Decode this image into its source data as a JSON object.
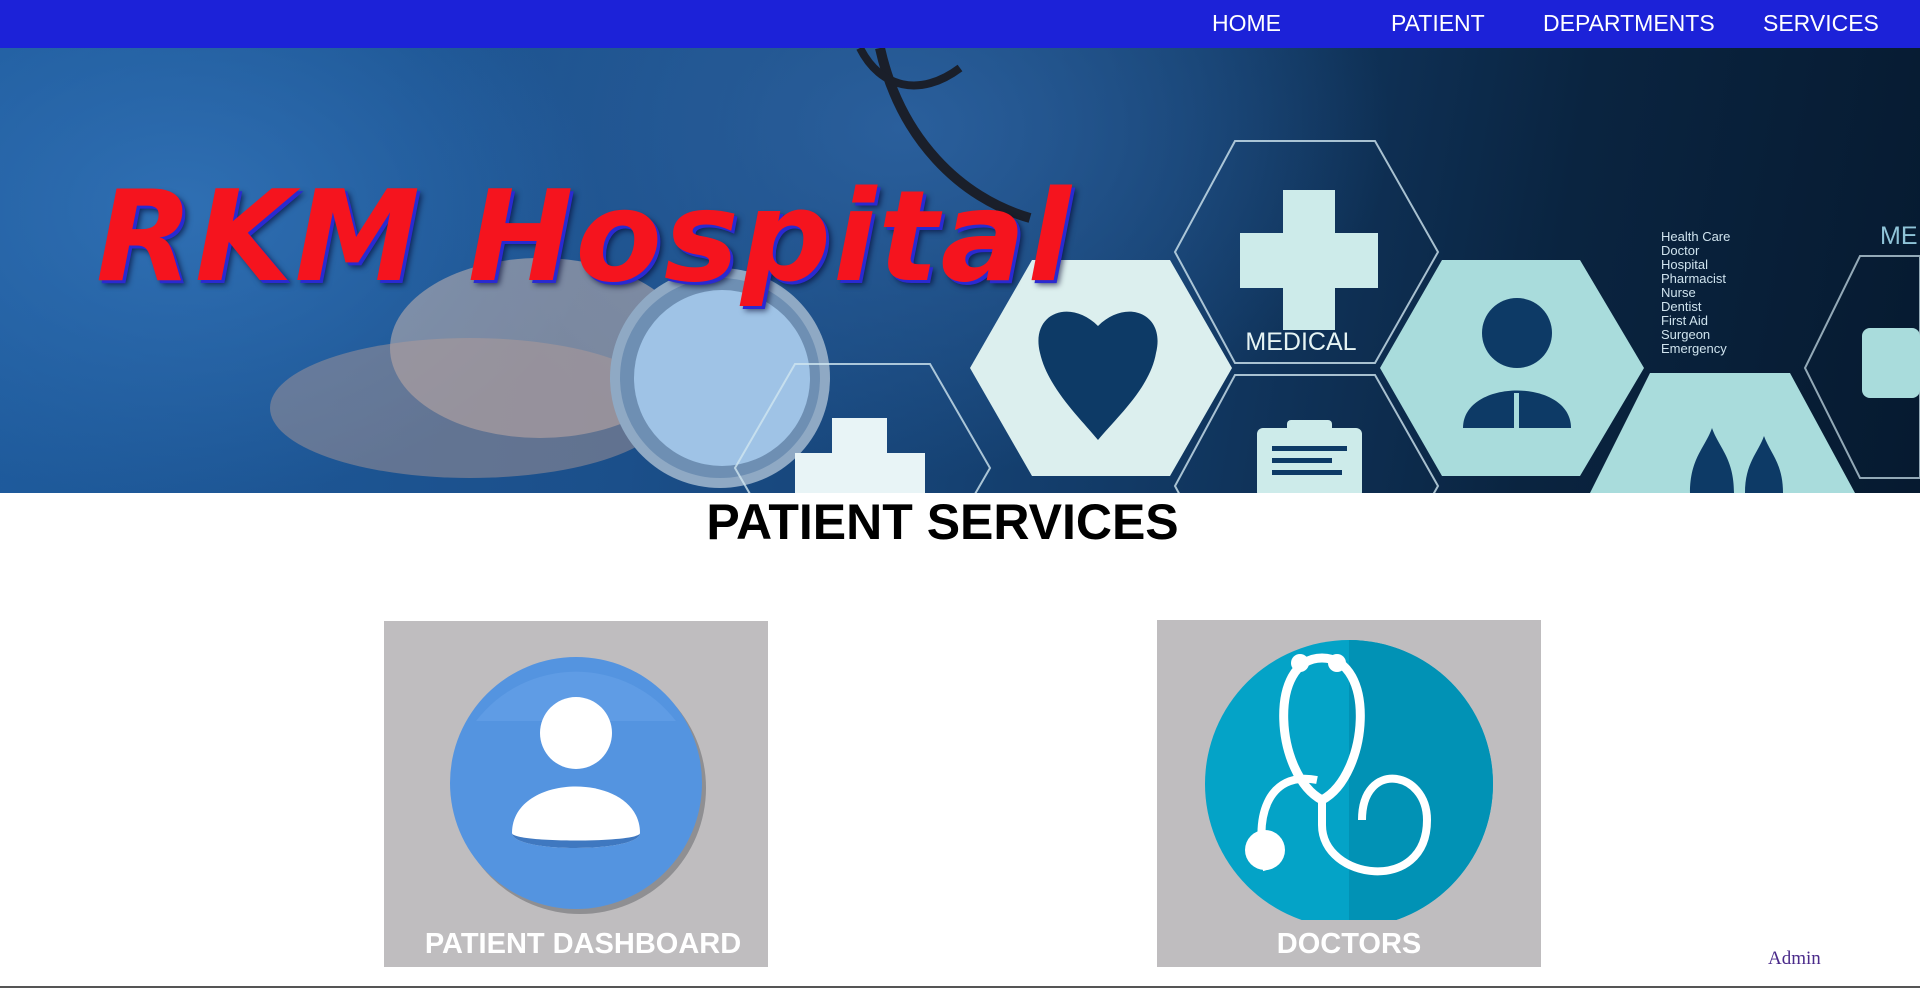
{
  "nav": {
    "home": "HOME",
    "patient": "PATIENT",
    "departments": "DEPARTMENTS",
    "services": "SERVICES"
  },
  "hero": {
    "title": "RKM Hospital",
    "hexagon_caption": "MEDICAL",
    "side_list": [
      "Health Care",
      "Doctor",
      "Hospital",
      "Pharmacist",
      "Nurse",
      "Dentist",
      "First Aid",
      "Surgeon",
      "Emergency"
    ],
    "edge_text": "ME"
  },
  "main": {
    "title": "PATIENT SERVICES",
    "cards": [
      {
        "label": "PATIENT DASHBOARD",
        "icon": "user-avatar-icon"
      },
      {
        "label": "DOCTORS",
        "icon": "stethoscope-icon"
      }
    ]
  },
  "footer": {
    "admin": "Admin"
  },
  "colors": {
    "nav_bg": "#1c22d8",
    "hero_title": "#f5141e",
    "card_bg": "#bfbdbf",
    "dashboard_icon": "#5494e0",
    "doctors_icon": "#04a3c7"
  }
}
